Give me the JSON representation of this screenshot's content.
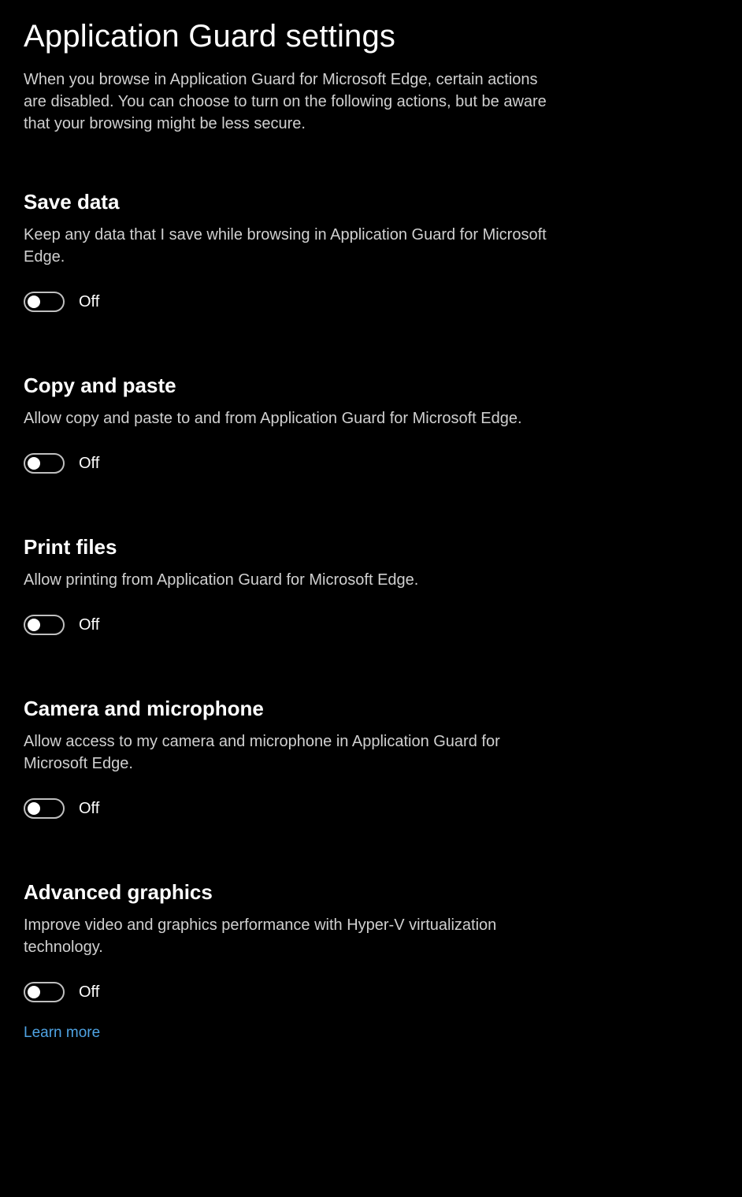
{
  "page": {
    "title": "Application Guard settings",
    "description": "When you browse in Application Guard for Microsoft Edge, certain actions are disabled. You can choose to turn on the following actions, but be aware that your browsing might be less secure."
  },
  "sections": {
    "saveData": {
      "title": "Save data",
      "description": "Keep any data that I save while browsing in Application Guard for Microsoft Edge.",
      "toggleState": "Off"
    },
    "copyPaste": {
      "title": "Copy and paste",
      "description": "Allow copy and paste to and from Application Guard for Microsoft Edge.",
      "toggleState": "Off"
    },
    "printFiles": {
      "title": "Print files",
      "description": "Allow printing from Application Guard for Microsoft Edge.",
      "toggleState": "Off"
    },
    "cameraMic": {
      "title": "Camera and microphone",
      "description": "Allow access to my camera and microphone in Application Guard for Microsoft Edge.",
      "toggleState": "Off"
    },
    "advancedGraphics": {
      "title": "Advanced graphics",
      "description": "Improve video and graphics performance with Hyper-V virtualization technology.",
      "toggleState": "Off"
    }
  },
  "learnMore": "Learn more"
}
